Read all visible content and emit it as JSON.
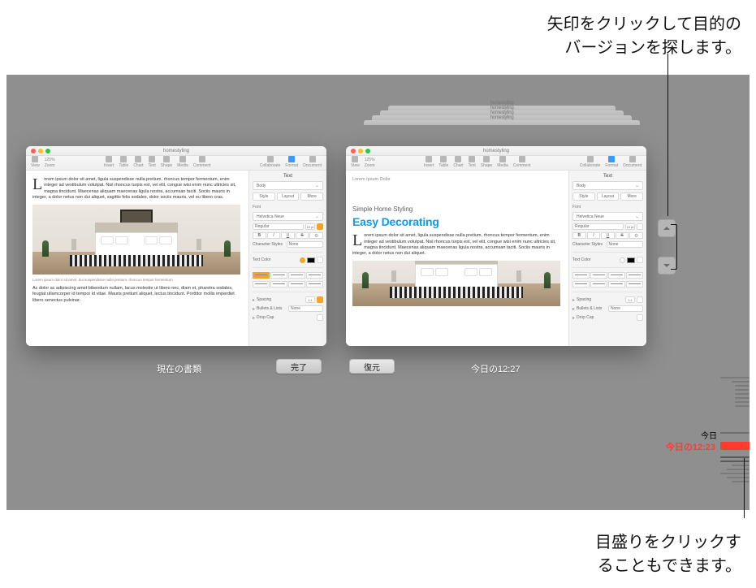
{
  "callouts": {
    "top_line1": "矢印をクリックして目的の",
    "top_line2": "バージョンを探します。",
    "bottom_line1": "目盛りをクリックす",
    "bottom_line2": "ることもできます。"
  },
  "buttons": {
    "done": "完了",
    "restore": "復元"
  },
  "labels": {
    "current_doc": "現在の書類",
    "version_time": "今日の12:27"
  },
  "timeline": {
    "today": "今日",
    "current": "今日の12:23"
  },
  "window": {
    "title": "homestyling",
    "toolbar": {
      "view": "View",
      "zoom_value": "125%",
      "zoom_label": "Zoom",
      "insert": "Insert",
      "table": "Table",
      "chart": "Chart",
      "text": "Text",
      "shape": "Shape",
      "media": "Media",
      "comment": "Comment",
      "collaborate": "Collaborate",
      "format": "Format",
      "document": "Document"
    },
    "inspector": {
      "tab": "Text",
      "paragraph_style": "Body",
      "seg_style": "Style",
      "seg_layout": "Layout",
      "seg_more": "More",
      "font_section": "Font",
      "font_name": "Helvetica Neue",
      "font_weight": "Regular",
      "font_size": "10 pt",
      "fmt_b": "B",
      "fmt_i": "I",
      "fmt_u": "U",
      "fmt_s": "S",
      "char_styles_label": "Character Styles",
      "char_styles_value": "None",
      "text_color_label": "Text Color",
      "spacing_label": "Spacing",
      "spacing_value": "1.1",
      "bullets_label": "Bullets & Lists",
      "bullets_value": "None",
      "drop_cap_label": "Drop Cap"
    }
  },
  "left_doc": {
    "para1": "Lorem ipsum dolor sit amet, ligula suspendisse nulla pretium, rhoncus tempor fermentum, enim integer ad vestibulum volutpat. Nisl rhoncus turpis est, vel elit, congue wisi enim nunc ultricies sit, magna tincidunt. Maecenas aliquam maecenas ligula nostra, accumsan taciti. Sociis mauris in integer, a dolor netus non dui aliquet, sagittis felis sodales, dolor sociis mauris, vel eu libero cras.",
    "caption": "Lorem ipsum dolor sit amet, dui suspendisse nulla pretium, rhoncus tempor fermentum.",
    "para2": "Ac dolor ac adipiscing amet bibendum nullam, lacus molestie ut libero nec, diam et, pharetra sodales, feugiat ullamcorper id tempor id vitae. Mauris pretium aliquet, lectus tincidunt. Porttitor mollis imperdiet libero senectus pulvinar."
  },
  "right_doc": {
    "eyebrow": "Lorem Ipsum Dolor",
    "heading3": "Simple Home Styling",
    "heading_blue": "Easy Decorating",
    "para1": "Lorem ipsum dolor sit amet, ligula suspendisse nulla pretium, rhoncus tempor fermentum, enim integer ad vestibulum volutpat. Nisl rhoncus turpis est, vel elit, congue wisi enim nunc ultricies sit, magna tincidunt. Maecenas aliquam maecenas ligula nostra, accumsan taciti. Sociis mauris in integer, a dolor netus non dui aliquet."
  },
  "stack_titles": [
    "homestyling",
    "homestyling",
    "homestyling",
    "homestyling"
  ]
}
